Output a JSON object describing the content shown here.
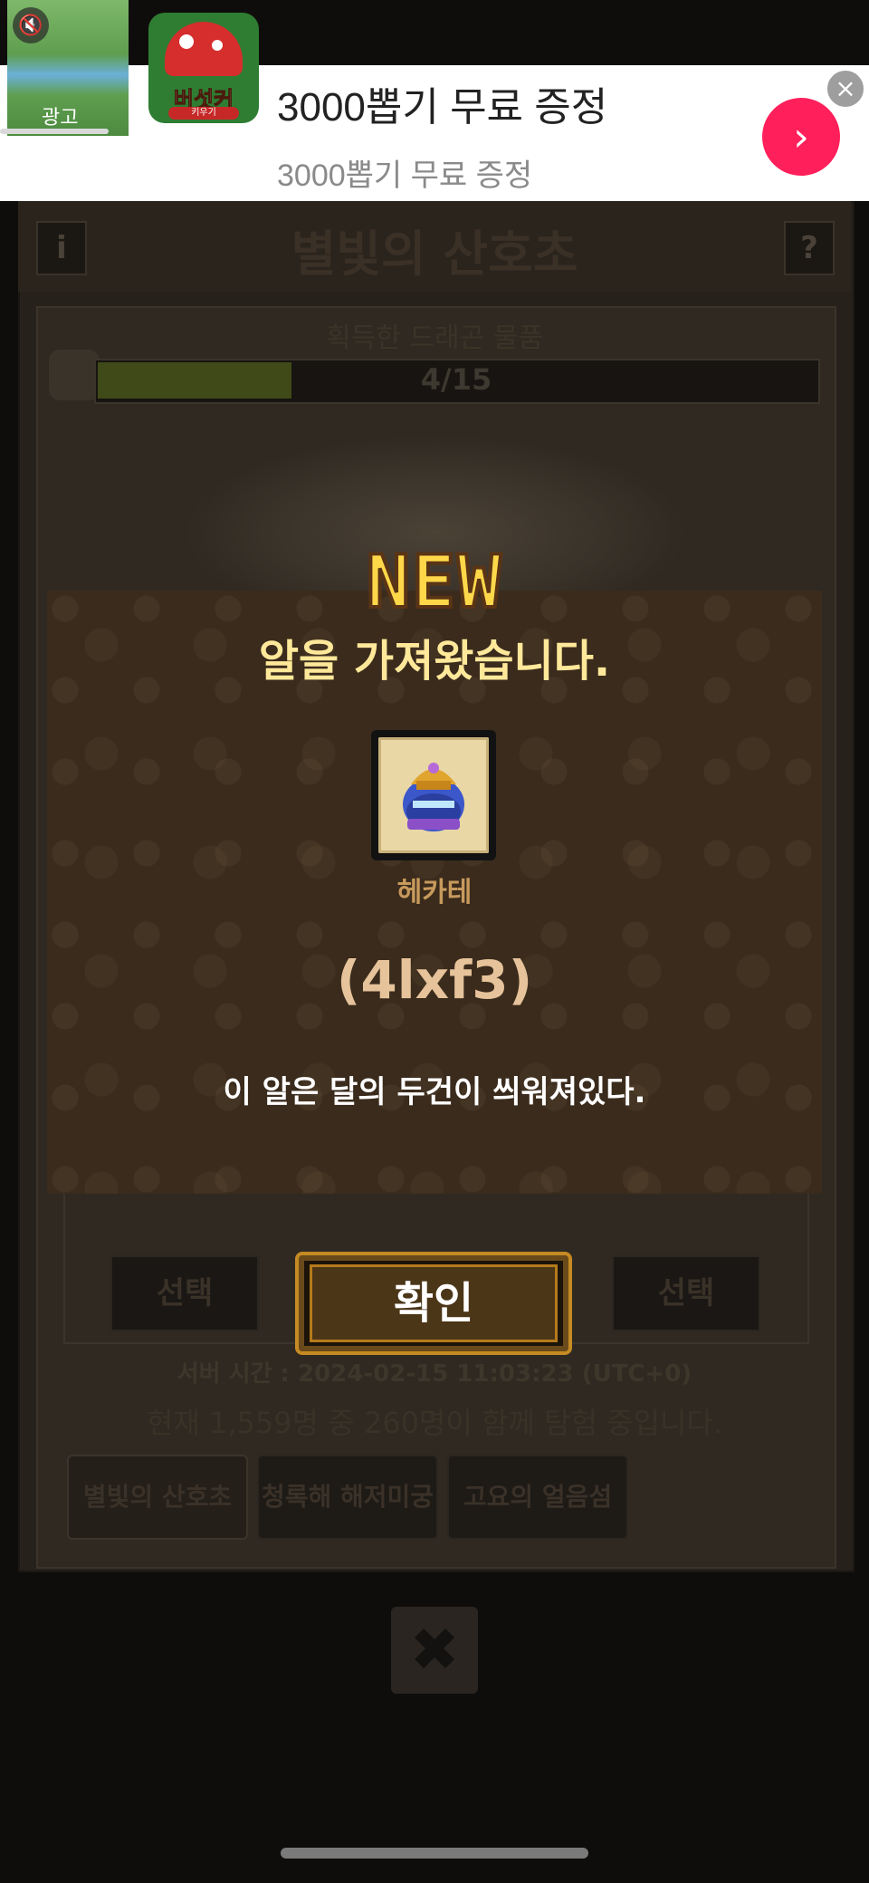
{
  "ad": {
    "tag": "광고",
    "app_brand": "버섯커",
    "app_brand_sub": "키우기",
    "title": "3000뽑기 무료 증정",
    "subtitle": "3000뽑기 무료 증정"
  },
  "background": {
    "title": "별빛의 산호초",
    "info_label": "i",
    "help_label": "?",
    "progress_label": "획득한 드래곤 물품",
    "progress_text": "4/15",
    "progress_value": 0.27,
    "select_left": "선택",
    "select_right": "선택",
    "server_time": "서버 시간 : 2024-02-15 11:03:23 (UTC+0)",
    "join_status": "현재 1,559명 중 260명이 함께 탐험 중입니다.",
    "tabs": [
      {
        "label": "별빛의 산호초"
      },
      {
        "label": "청록해 해저미궁"
      },
      {
        "label": "고요의 얼음섬"
      }
    ],
    "close_label": "✖"
  },
  "popup": {
    "badge": "NEW",
    "title": "알을 가져왔습니다.",
    "egg_name": "헤카테",
    "egg_code": "(4lxf3)",
    "description": "이 알은 달의 두건이 씌워져있다.",
    "confirm_label": "확인"
  },
  "colors": {
    "popup_bg": "#3a2b1c",
    "title_yellow": "#ffe89a",
    "ad_cta": "#ff1f5a"
  }
}
